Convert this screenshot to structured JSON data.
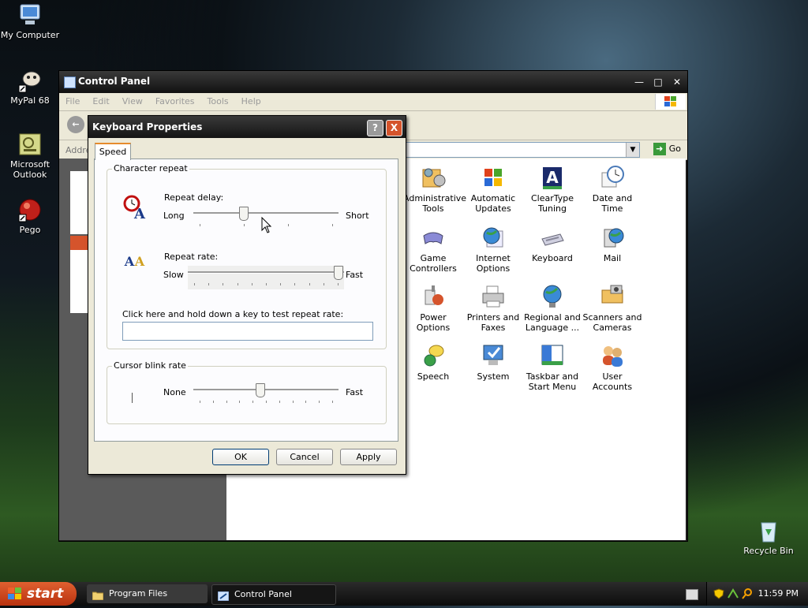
{
  "desktop": {
    "icons": [
      {
        "label": "My Computer"
      },
      {
        "label": "MyPal 68"
      },
      {
        "label": "Microsoft Outlook"
      },
      {
        "label": "Pego"
      },
      {
        "label": "Recycle Bin"
      }
    ]
  },
  "control_panel": {
    "title": "Control Panel",
    "menu": [
      "File",
      "Edit",
      "View",
      "Favorites",
      "Tools",
      "Help"
    ],
    "address_label": "Addre",
    "go_label": "Go",
    "items": [
      {
        "label": "Administrative Tools",
        "icon": "administrative-tools-icon"
      },
      {
        "label": "Automatic Updates",
        "icon": "automatic-updates-icon"
      },
      {
        "label": "ClearType Tuning",
        "icon": "cleartype-icon"
      },
      {
        "label": "Date and Time",
        "icon": "clock-icon"
      },
      {
        "label": "Game Controllers",
        "icon": "gamepad-icon"
      },
      {
        "label": "Internet Options",
        "icon": "globe-icon"
      },
      {
        "label": "Keyboard",
        "icon": "keyboard-icon"
      },
      {
        "label": "Mail",
        "icon": "mail-icon"
      },
      {
        "label": "Power Options",
        "icon": "power-icon"
      },
      {
        "label": "Printers and Faxes",
        "icon": "printer-icon"
      },
      {
        "label": "Regional and Language ...",
        "icon": "regional-globe-icon"
      },
      {
        "label": "Scanners and Cameras",
        "icon": "scanner-icon"
      },
      {
        "label": "Speech",
        "icon": "speech-icon"
      },
      {
        "label": "System",
        "icon": "system-icon"
      },
      {
        "label": "Taskbar and Start Menu",
        "icon": "taskbar-icon"
      },
      {
        "label": "User Accounts",
        "icon": "users-icon"
      }
    ]
  },
  "dialog": {
    "title": "Keyboard Properties",
    "help": "?",
    "close": "X",
    "tab": "Speed",
    "character_repeat": {
      "group_label": "Character repeat",
      "delay_label": "Repeat delay:",
      "delay_min": "Long",
      "delay_max": "Short",
      "delay_value": 0.33,
      "rate_label": "Repeat rate:",
      "rate_min": "Slow",
      "rate_max": "Fast",
      "rate_value": 1.0,
      "test_label": "Click here and hold down a key to test repeat rate:",
      "test_value": ""
    },
    "cursor_blink": {
      "group_label": "Cursor blink rate",
      "min": "None",
      "max": "Fast",
      "value": 0.45
    },
    "buttons": {
      "ok": "OK",
      "cancel": "Cancel",
      "apply": "Apply"
    }
  },
  "taskbar": {
    "start_label": "start",
    "tasks": [
      {
        "label": "Program Files"
      },
      {
        "label": "Control Panel"
      }
    ],
    "clock": "11:59 PM"
  }
}
